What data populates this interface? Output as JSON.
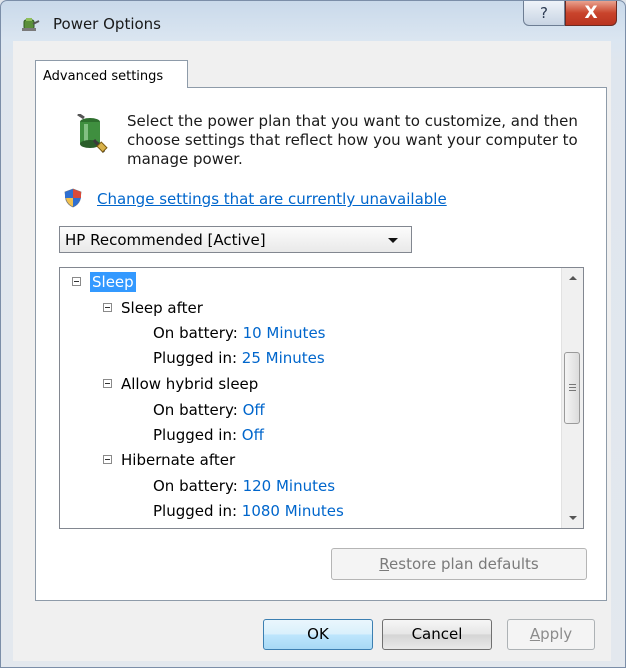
{
  "window": {
    "title": "Power Options",
    "help_label": "?",
    "close_label": "X"
  },
  "tab": {
    "label": "Advanced settings"
  },
  "description": "Select the power plan that you want to customize, and then choose settings that reflect how you want your computer to manage power.",
  "change_link": "Change settings that are currently unavailable",
  "plan_select": {
    "value": "HP Recommended [Active]"
  },
  "tree": {
    "sleep": "Sleep",
    "sleep_after": {
      "label": "Sleep after",
      "battery_label": "On battery:",
      "battery_value": "10 Minutes",
      "plugged_label": "Plugged in:",
      "plugged_value": "25 Minutes"
    },
    "hybrid_sleep": {
      "label": "Allow hybrid sleep",
      "battery_label": "On battery:",
      "battery_value": "Off",
      "plugged_label": "Plugged in:",
      "plugged_value": "Off"
    },
    "hibernate_after": {
      "label": "Hibernate after",
      "battery_label": "On battery:",
      "battery_value": "120 Minutes",
      "plugged_label": "Plugged in:",
      "plugged_value": "1080 Minutes"
    }
  },
  "buttons": {
    "restore_prefix": "R",
    "restore_rest": "estore plan defaults",
    "ok": "OK",
    "cancel": "Cancel",
    "apply_prefix": "A",
    "apply_rest": "pply"
  }
}
